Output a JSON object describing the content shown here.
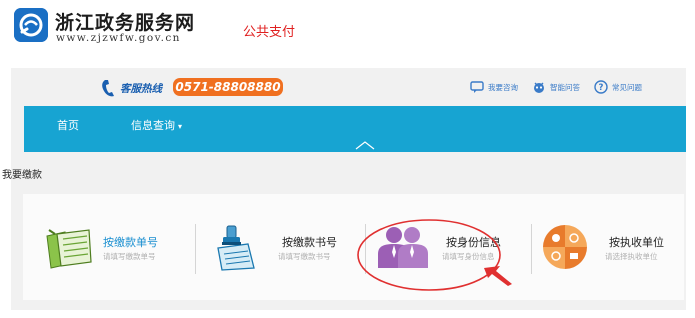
{
  "header": {
    "site_name": "浙江政务服务网",
    "site_domain": "www.zjzwfw.gov.cn",
    "page_tag": "公共支付"
  },
  "hotline": {
    "label": "客服热线",
    "number": "0571-88808880"
  },
  "top_links": [
    {
      "label": "我要咨询",
      "icon": "chat-icon"
    },
    {
      "label": "智能问答",
      "icon": "robot-icon"
    },
    {
      "label": "常见问题",
      "icon": "help-circle-icon"
    }
  ],
  "nav": {
    "items": [
      {
        "label": "首页"
      },
      {
        "label": "信息查询",
        "caret": "▾"
      }
    ]
  },
  "section": {
    "title": "我要缴款"
  },
  "methods": [
    {
      "title": "按缴款单号",
      "desc": "请填写缴款单号",
      "icon": "receipt-icon",
      "highlight": true
    },
    {
      "title": "按缴款书号",
      "desc": "请填写缴款书号",
      "icon": "stamp-document-icon",
      "highlight": false
    },
    {
      "title": "按身份信息",
      "desc": "请填写身份信息",
      "icon": "users-icon",
      "highlight": false
    },
    {
      "title": "按执收单位",
      "desc": "请选择执收单位",
      "icon": "org-unit-icon",
      "highlight": false
    }
  ],
  "colors": {
    "nav_bg": "#17a4d2",
    "hotline_bg": "#f07020",
    "highlight_text": "#1a8fd0",
    "annotation": "#e03030",
    "page_tag": "#e02020"
  }
}
